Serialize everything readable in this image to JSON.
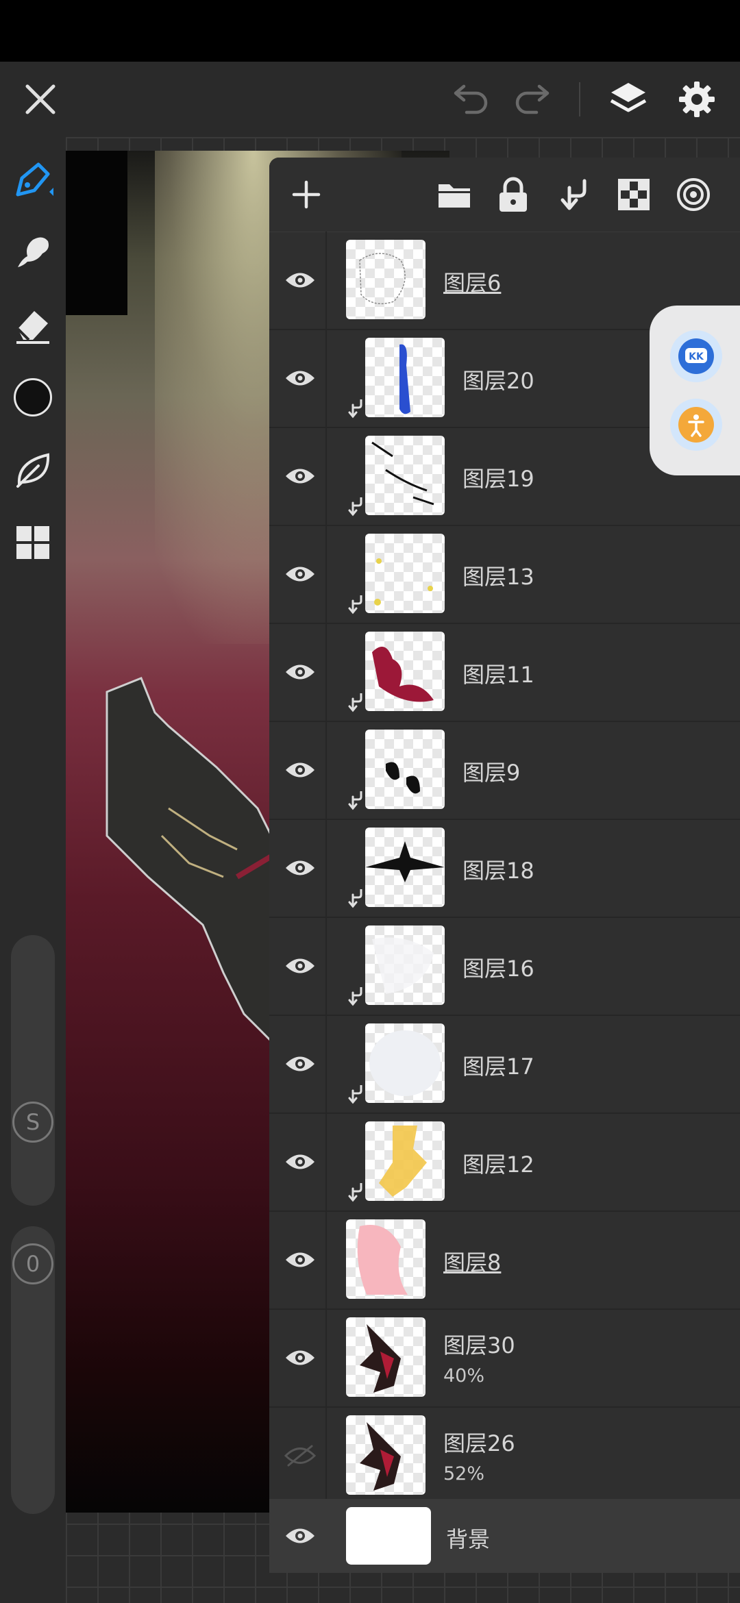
{
  "topbar": {
    "icons": [
      "close-icon",
      "undo-icon",
      "redo-icon",
      "layers-icon",
      "settings-icon"
    ]
  },
  "left_toolbar": {
    "tools": [
      "pen-tool",
      "smudge-tool",
      "eraser-tool",
      "color-swatch",
      "leaf-tool",
      "gallery-grid"
    ],
    "size_slider_label": "S",
    "opacity_slider_label": "0"
  },
  "layers_panel": {
    "toolbar_icons": [
      "add-icon",
      "folder-icon",
      "lock-icon",
      "clip-down-icon",
      "checker-icon",
      "target-icon"
    ],
    "layers": [
      {
        "name": "图层6",
        "clipped": false,
        "underlined": true,
        "visible": true,
        "opacity": ""
      },
      {
        "name": "图层20",
        "clipped": true,
        "underlined": false,
        "visible": true,
        "opacity": ""
      },
      {
        "name": "图层19",
        "clipped": true,
        "underlined": false,
        "visible": true,
        "opacity": ""
      },
      {
        "name": "图层13",
        "clipped": true,
        "underlined": false,
        "visible": true,
        "opacity": ""
      },
      {
        "name": "图层11",
        "clipped": true,
        "underlined": false,
        "visible": true,
        "opacity": ""
      },
      {
        "name": "图层9",
        "clipped": true,
        "underlined": false,
        "visible": true,
        "opacity": ""
      },
      {
        "name": "图层18",
        "clipped": true,
        "underlined": false,
        "visible": true,
        "opacity": ""
      },
      {
        "name": "图层16",
        "clipped": true,
        "underlined": false,
        "visible": true,
        "opacity": ""
      },
      {
        "name": "图层17",
        "clipped": true,
        "underlined": false,
        "visible": true,
        "opacity": ""
      },
      {
        "name": "图层12",
        "clipped": true,
        "underlined": false,
        "visible": true,
        "opacity": ""
      },
      {
        "name": "图层8",
        "clipped": false,
        "underlined": true,
        "visible": true,
        "opacity": ""
      },
      {
        "name": "图层30",
        "clipped": false,
        "underlined": false,
        "visible": true,
        "opacity": "40%"
      },
      {
        "name": "图层26",
        "clipped": false,
        "underlined": false,
        "visible": false,
        "opacity": "52%"
      }
    ],
    "background_layer": {
      "name": "背景",
      "visible": true
    }
  },
  "floating_widget": {
    "icons": [
      "kk-assistant-icon",
      "accessibility-assistant-icon"
    ]
  },
  "colors": {
    "accent": "#2196f3",
    "panel_bg": "#2f2f2f",
    "toolbar_bg": "#2a2a2a"
  }
}
